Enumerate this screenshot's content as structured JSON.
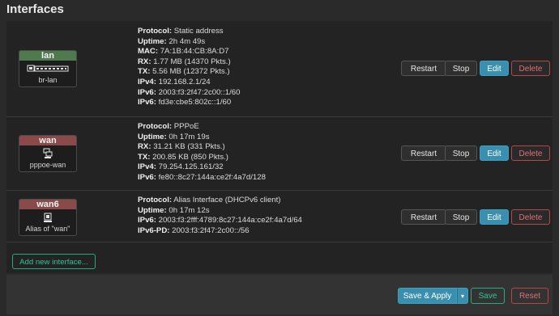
{
  "page_title": "Interfaces",
  "interfaces": [
    {
      "name": "lan",
      "device": "br-lan",
      "icon": "bridge-icon",
      "details": [
        {
          "label": "Protocol:",
          "value": "Static address"
        },
        {
          "label": "Uptime:",
          "value": "2h 4m 49s"
        },
        {
          "label": "MAC:",
          "value": "7A:1B:44:CB:8A:D7"
        },
        {
          "label": "RX:",
          "value": "1.77 MB (14370 Pkts.)"
        },
        {
          "label": "TX:",
          "value": "5.56 MB (12372 Pkts.)"
        },
        {
          "label": "IPv4:",
          "value": "192.168.2.1/24"
        },
        {
          "label": "IPv6:",
          "value": "2003:f3:2f47:2c00::1/60"
        },
        {
          "label": "IPv6:",
          "value": "fd3e:cbe5:802c::1/60"
        }
      ]
    },
    {
      "name": "wan",
      "device": "pppoe-wan",
      "icon": "network-icon",
      "details": [
        {
          "label": "Protocol:",
          "value": "PPPoE"
        },
        {
          "label": "Uptime:",
          "value": "0h 17m 19s"
        },
        {
          "label": "RX:",
          "value": "31.21 KB (331 Pkts.)"
        },
        {
          "label": "TX:",
          "value": "200.85 KB (850 Pkts.)"
        },
        {
          "label": "IPv4:",
          "value": "79.254.125.161/32"
        },
        {
          "label": "IPv6:",
          "value": "fe80::8c27:144a:ce2f:4a7d/128"
        }
      ]
    },
    {
      "name": "wan6",
      "device": "Alias of \"wan\"",
      "icon": "alias-icon",
      "details": [
        {
          "label": "Protocol:",
          "value": "Alias Interface (DHCPv6 client)"
        },
        {
          "label": "Uptime:",
          "value": "0h 17m 12s"
        },
        {
          "label": "IPv6:",
          "value": "2003:f3:2fff:4789:8c27:144a:ce2f:4a7d/64"
        },
        {
          "label": "IPv6-PD:",
          "value": "2003:f3:2f47:2c00::/56"
        }
      ]
    }
  ],
  "row_buttons": {
    "restart": "Restart",
    "stop": "Stop",
    "edit": "Edit",
    "delete": "Delete"
  },
  "add_interface_label": "Add new interface...",
  "footer": {
    "save_apply": "Save & Apply",
    "caret": "▾",
    "save": "Save",
    "reset": "Reset"
  },
  "colors": {
    "lan_header": "#4e7a4e",
    "wan_header": "#8a4a4a",
    "edit_button": "#3a8fae",
    "delete_border": "#b04a4a",
    "save_border": "#2aa882"
  }
}
